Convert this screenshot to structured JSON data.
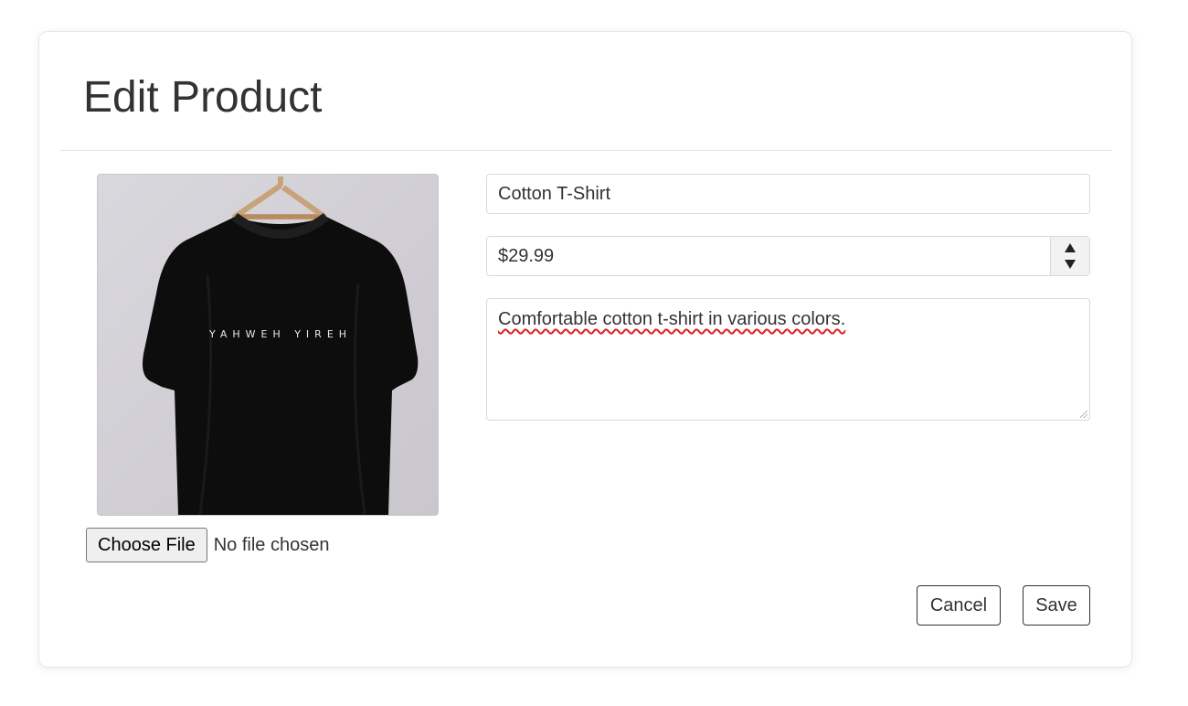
{
  "page": {
    "title": "Edit Product"
  },
  "image": {
    "shirt_print": "YAHWEH YIREH",
    "icon": "product-image"
  },
  "file_input": {
    "button_label": "Choose File",
    "status": "No file chosen"
  },
  "form": {
    "name_value": "Cotton T-Shirt",
    "price_value": "$29.99",
    "description_value": "Comfortable cotton t-shirt in various colors."
  },
  "actions": {
    "cancel_label": "Cancel",
    "save_label": "Save"
  },
  "colors": {
    "text": "#333333",
    "border": "#d9d9d9",
    "spellcheck": "#e02020"
  }
}
